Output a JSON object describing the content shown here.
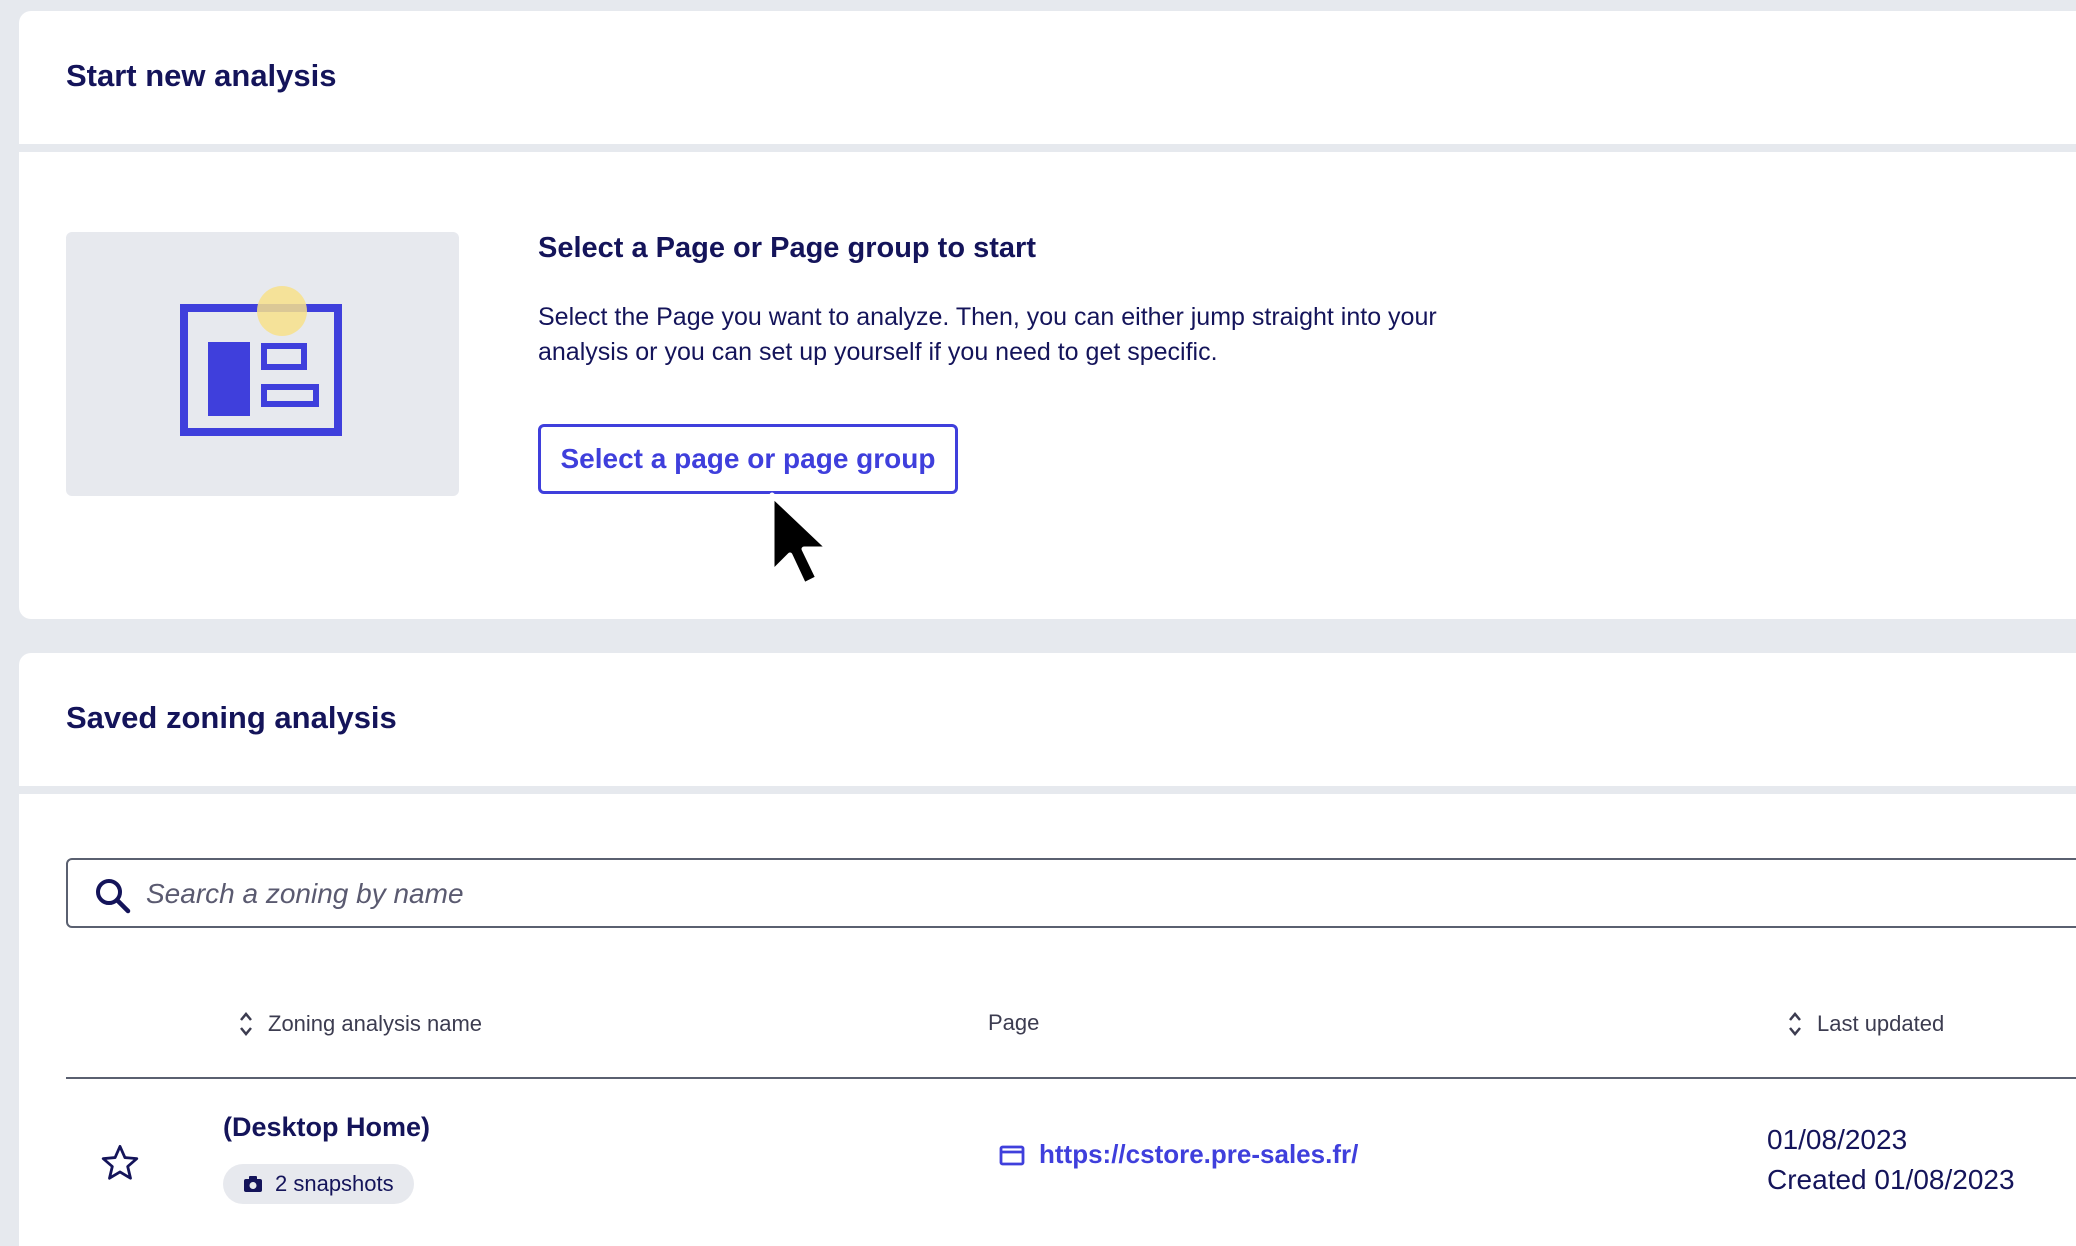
{
  "new_analysis": {
    "title": "Start new analysis",
    "intro_title": "Select a Page or Page group to start",
    "intro_text": "Select the Page you want to analyze. Then, you can either jump straight into your analysis or you can set up yourself if you need to get specific.",
    "select_button": "Select a page or page group",
    "illustration_icon": "page-layout-icon"
  },
  "saved": {
    "title": "Saved zoning analysis",
    "search_placeholder": "Search a zoning by name",
    "columns": {
      "name": "Zoning analysis name",
      "page": "Page",
      "last_updated": "Last updated"
    },
    "rows": [
      {
        "name": "(Desktop Home)",
        "snapshots": "2 snapshots",
        "page_url": "https://cstore.pre-sales.fr/",
        "last_updated": "01/08/2023",
        "created": "Created 01/08/2023",
        "favorite": false
      }
    ]
  },
  "colors": {
    "accent": "#3f3fdc",
    "text_primary": "#14145a",
    "background": "#e6e9ee",
    "highlight_dot": "#f7e08a"
  }
}
